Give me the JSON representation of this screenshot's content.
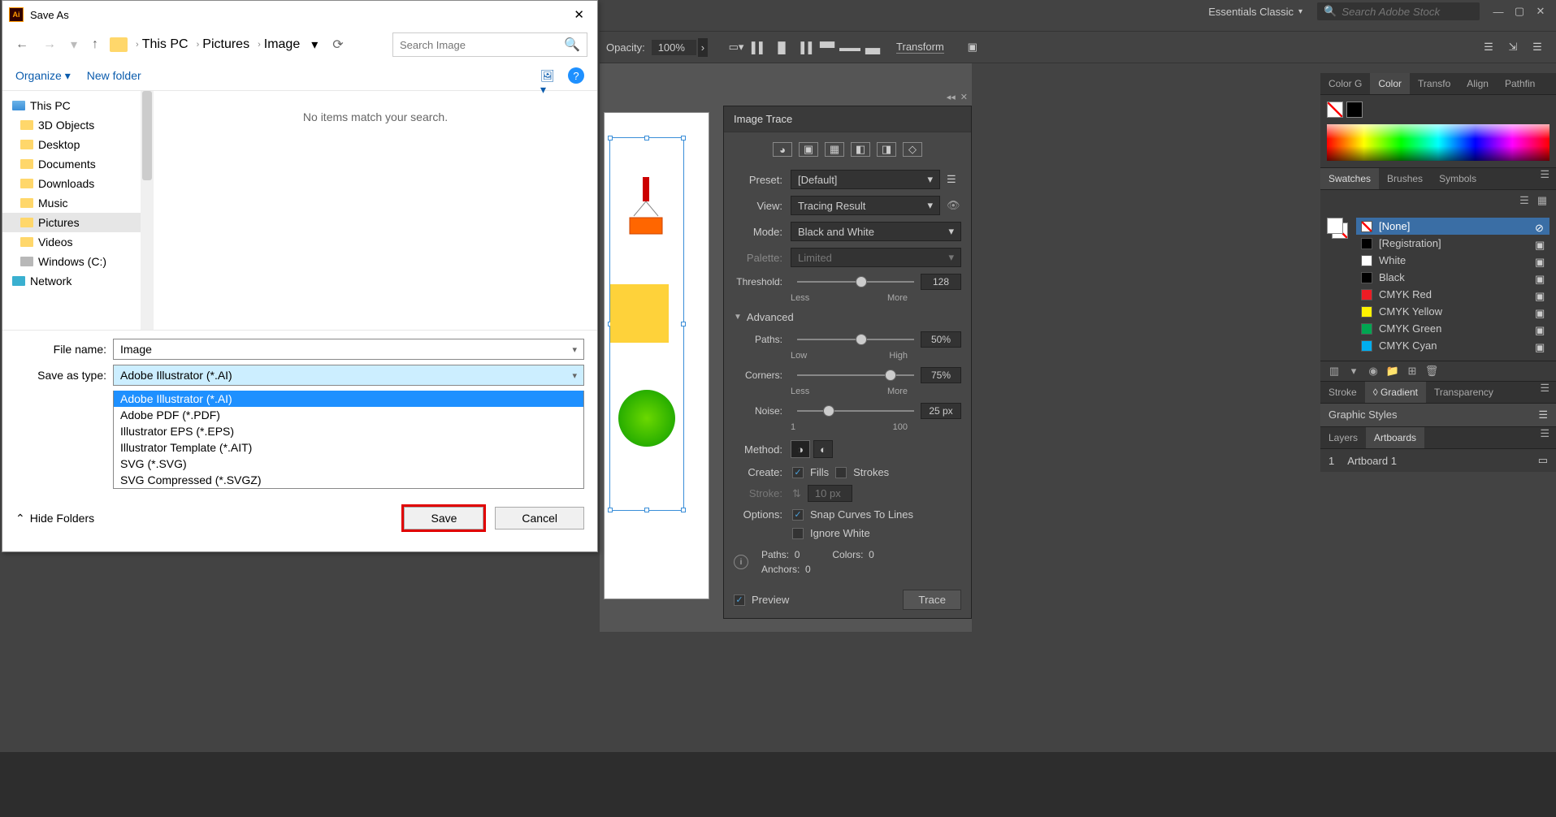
{
  "app": {
    "workspace": "Essentials Classic",
    "search_placeholder": "Search Adobe Stock"
  },
  "controlbar": {
    "opacity_label": "Opacity:",
    "opacity_value": "100%",
    "transform": "Transform"
  },
  "image_trace": {
    "title": "Image Trace",
    "preset_label": "Preset:",
    "preset_value": "[Default]",
    "view_label": "View:",
    "view_value": "Tracing Result",
    "mode_label": "Mode:",
    "mode_value": "Black and White",
    "palette_label": "Palette:",
    "palette_value": "Limited",
    "threshold_label": "Threshold:",
    "threshold_value": "128",
    "threshold_min": "Less",
    "threshold_max": "More",
    "advanced": "Advanced",
    "paths_label": "Paths:",
    "paths_value": "50%",
    "paths_min": "Low",
    "paths_max": "High",
    "corners_label": "Corners:",
    "corners_value": "75%",
    "corners_min": "Less",
    "corners_max": "More",
    "noise_label": "Noise:",
    "noise_value": "25 px",
    "noise_min": "1",
    "noise_max": "100",
    "method_label": "Method:",
    "create_label": "Create:",
    "fills_label": "Fills",
    "strokes_label": "Strokes",
    "stroke_label": "Stroke:",
    "stroke_value": "10 px",
    "options_label": "Options:",
    "snap_label": "Snap Curves To Lines",
    "ignore_label": "Ignore White",
    "info_paths": "Paths:",
    "info_paths_v": "0",
    "info_colors": "Colors:",
    "info_colors_v": "0",
    "info_anchors": "Anchors:",
    "info_anchors_v": "0",
    "preview_label": "Preview",
    "trace_button": "Trace"
  },
  "color_panel": {
    "tabs": [
      "Color G",
      "Color",
      "Transfo",
      "Align",
      "Pathfin"
    ],
    "swatch_tabs": [
      "Swatches",
      "Brushes",
      "Symbols"
    ],
    "swatches": [
      {
        "name": "[None]",
        "color": "none"
      },
      {
        "name": "[Registration]",
        "color": "#000"
      },
      {
        "name": "White",
        "color": "#fff"
      },
      {
        "name": "Black",
        "color": "#000"
      },
      {
        "name": "CMYK Red",
        "color": "#ed1c24"
      },
      {
        "name": "CMYK Yellow",
        "color": "#fff200"
      },
      {
        "name": "CMYK Green",
        "color": "#00a651"
      },
      {
        "name": "CMYK Cyan",
        "color": "#00aeef"
      }
    ],
    "stroke_tabs": [
      "Stroke",
      "Gradient",
      "Transparency"
    ],
    "gradient_prefix": "◊",
    "graphic_styles": "Graphic Styles",
    "layer_tabs": [
      "Layers",
      "Artboards"
    ],
    "artboard_num": "1",
    "artboard_name": "Artboard 1"
  },
  "dialog": {
    "title": "Save As",
    "breadcrumb": [
      "This PC",
      "Pictures",
      "Image"
    ],
    "search_placeholder": "Search Image",
    "organize": "Organize",
    "new_folder": "New folder",
    "tree": [
      {
        "name": "This PC",
        "icon": "pc",
        "bold": true
      },
      {
        "name": "3D Objects",
        "icon": "folder"
      },
      {
        "name": "Desktop",
        "icon": "folder"
      },
      {
        "name": "Documents",
        "icon": "folder"
      },
      {
        "name": "Downloads",
        "icon": "folder"
      },
      {
        "name": "Music",
        "icon": "folder"
      },
      {
        "name": "Pictures",
        "icon": "folder",
        "selected": true
      },
      {
        "name": "Videos",
        "icon": "folder"
      },
      {
        "name": "Windows (C:)",
        "icon": "disk"
      },
      {
        "name": "Network",
        "icon": "network",
        "bold": true
      }
    ],
    "empty_msg": "No items match your search.",
    "filename_label": "File name:",
    "filename_value": "Image",
    "savetype_label": "Save as type:",
    "savetype_value": "Adobe Illustrator (*.AI)",
    "type_options": [
      "Adobe Illustrator (*.AI)",
      "Adobe PDF (*.PDF)",
      "Illustrator EPS (*.EPS)",
      "Illustrator Template (*.AIT)",
      "SVG (*.SVG)",
      "SVG Compressed (*.SVGZ)"
    ],
    "hide_folders": "Hide Folders",
    "save_button": "Save",
    "cancel_button": "Cancel"
  }
}
